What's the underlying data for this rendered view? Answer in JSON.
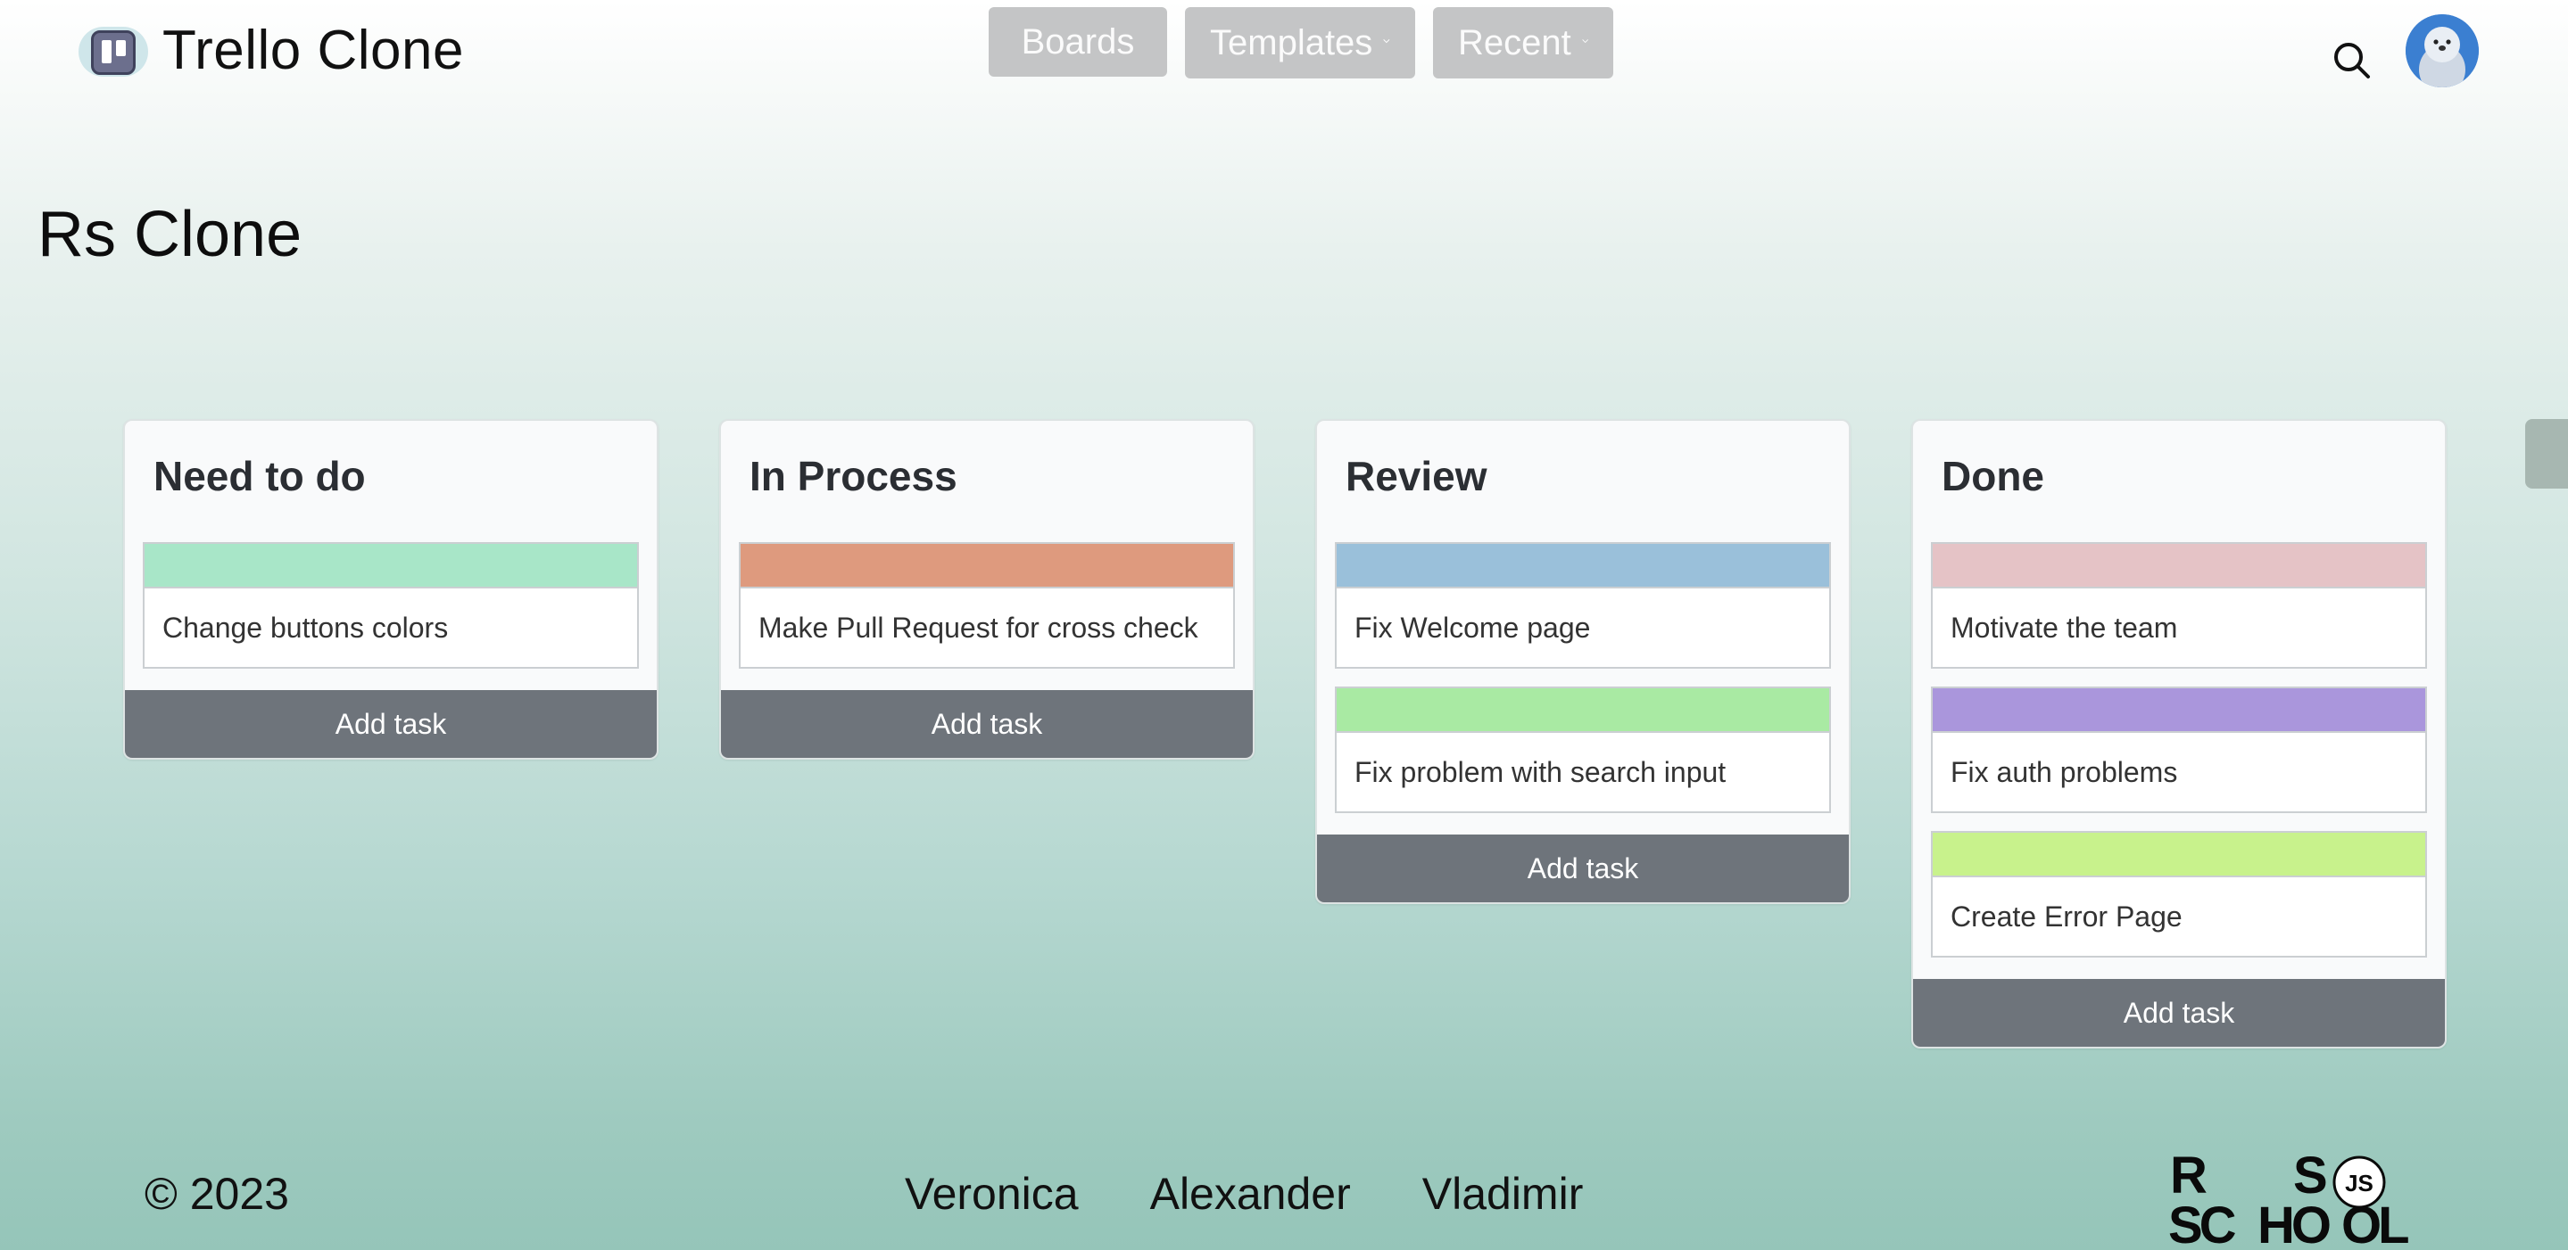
{
  "app": {
    "title": "Trello Clone"
  },
  "nav": {
    "boards": "Boards",
    "templates": "Templates",
    "recent": "Recent"
  },
  "board": {
    "title": "Rs Clone"
  },
  "columns": [
    {
      "title": "Need to do",
      "cards": [
        {
          "text": "Change buttons colors",
          "color": "#a8e6c8"
        }
      ],
      "add_label": "Add task"
    },
    {
      "title": "In Process",
      "cards": [
        {
          "text": "Make Pull Request for cross check",
          "color": "#de9a7e"
        }
      ],
      "add_label": "Add task"
    },
    {
      "title": "Review",
      "cards": [
        {
          "text": "Fix Welcome page",
          "color": "#9ac0da"
        },
        {
          "text": "Fix problem with search input",
          "color": "#a9eaa3"
        }
      ],
      "add_label": "Add task"
    },
    {
      "title": "Done",
      "cards": [
        {
          "text": "Motivate the team",
          "color": "#e5c3c6"
        },
        {
          "text": "Fix auth problems",
          "color": "#aa96dc"
        },
        {
          "text": "Create Error Page",
          "color": "#c8f28c"
        }
      ],
      "add_label": "Add task"
    }
  ],
  "footer": {
    "copyright": "© 2023",
    "authors": [
      "Veronica",
      "Alexander",
      "Vladimir"
    ],
    "logo_letters": {
      "r": "R",
      "s": "S",
      "js": "JS",
      "sc": "SC",
      "ho": "HO",
      "ol": "OL"
    }
  },
  "icons": {
    "logo": "trello-board-icon",
    "search": "search-icon",
    "avatar": "seal-avatar-icon",
    "dropdown": "chevron-down-icon"
  },
  "colors": {
    "nav_button": "#c4c5c6",
    "add_button": "#6e747b"
  }
}
